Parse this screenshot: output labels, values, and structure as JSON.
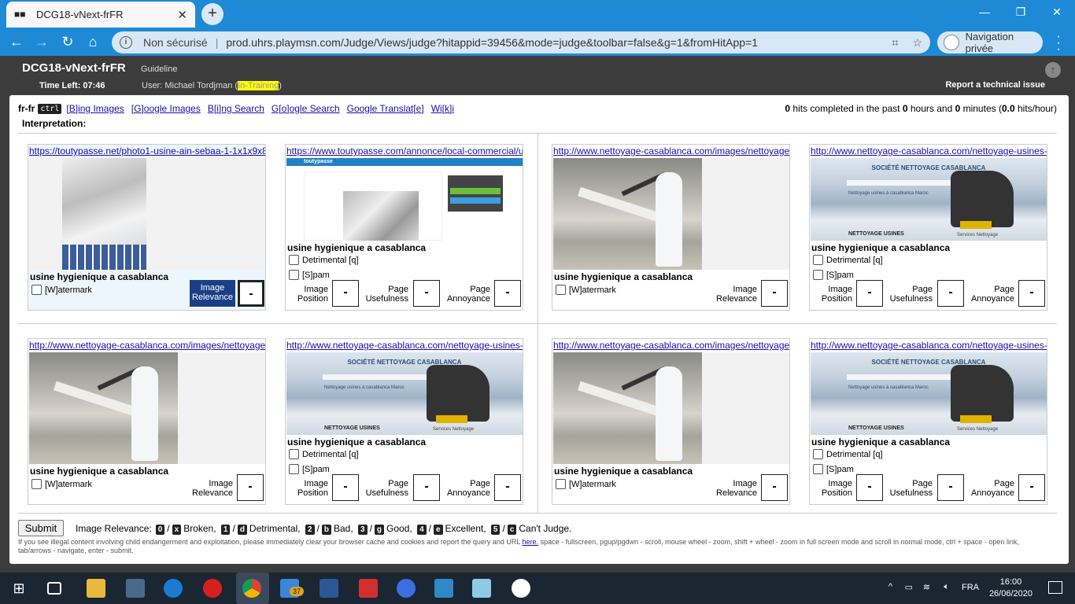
{
  "browser": {
    "tab_title": "DCG18-vNext-frFR",
    "security": "Non sécurisé",
    "url": "prod.uhrs.playmsn.com/Judge/Views/judge?hitappid=39456&mode=judge&toolbar=false&g=1&fromHitApp=1",
    "profile": "Navigation privée"
  },
  "header": {
    "app_name": "DCG18-vNext-frFR",
    "guideline": "Guideline",
    "time_left": "Time Left: 07:46",
    "user_prefix": "User: Michael Tordjman (",
    "user_status": "In-Training",
    "user_suffix": ")",
    "report": "Report a technical issue"
  },
  "toolbar": {
    "locale": "fr-fr",
    "ctrl": "ctrl",
    "links": [
      "[B]ing Images",
      "[G]oogle Images",
      "B[i]ng Search",
      "G[o]ogle Search",
      "Google Translat[e]",
      "Wi[k]i"
    ],
    "interpretation": "Interpretation:",
    "stats_parts": [
      "0",
      " hits completed in the past ",
      "0",
      " hours and ",
      "0",
      " minutes (",
      "0.0",
      " hits/hour)"
    ]
  },
  "cards": [
    {
      "url": "https://toutypasse.net/photo1-usine-ain-sebaa-1-1x1x9x8",
      "query": "usine hygienique a casablanca",
      "type": "image"
    },
    {
      "url": "https://www.toutypasse.com/annonce/local-commercial/u",
      "query": "usine hygienique a casablanca",
      "type": "page"
    },
    {
      "url": "http://www.nettoyage-casablanca.com/images/nettoyage",
      "query": "usine hygienique a casablanca",
      "type": "image"
    },
    {
      "url": "http://www.nettoyage-casablanca.com/nettoyage-usines-",
      "query": "usine hygienique a casablanca",
      "type": "page"
    },
    {
      "url": "http://www.nettoyage-casablanca.com/images/nettoyage",
      "query": "usine hygienique a casablanca",
      "type": "image"
    },
    {
      "url": "http://www.nettoyage-casablanca.com/nettoyage-usines-",
      "query": "usine hygienique a casablanca",
      "type": "page"
    },
    {
      "url": "http://www.nettoyage-casablanca.com/images/nettoyage",
      "query": "usine hygienique a casablanca",
      "type": "image"
    },
    {
      "url": "http://www.nettoyage-casablanca.com/nettoyage-usines-",
      "query": "usine hygienique a casablanca",
      "type": "page"
    }
  ],
  "labels": {
    "watermark": "[W]atermark",
    "detrimental": "Detrimental [q]",
    "spam": "[S]pam",
    "image_relevance_1": "Image",
    "image_relevance_2": "Relevance",
    "image_position_1": "Image",
    "image_position_2": "Position",
    "page_usefulness_1": "Page",
    "page_usefulness_2": "Usefulness",
    "page_annoyance_1": "Page",
    "page_annoyance_2": "Annoyance",
    "rating_value": "-"
  },
  "web_thumbs": {
    "toutypasse_logo": "toutypasse",
    "nettoyage_title": "SOCIÉTÉ NETTOYAGE CASABLANCA",
    "nettoyage_sub": "Nettoyage usines à casablanca Maroc",
    "nettoyage_bottom": "NETTOYAGE USINES",
    "nettoyage_services": "Services Nettoyage"
  },
  "footer": {
    "submit": "Submit",
    "legend_intro": "Image Relevance:",
    "legend": [
      {
        "k1": "0",
        "k2": "x",
        "label": "Broken,"
      },
      {
        "k1": "1",
        "k2": "d",
        "label": "Detrimental,"
      },
      {
        "k1": "2",
        "k2": "b",
        "label": "Bad,"
      },
      {
        "k1": "3",
        "k2": "g",
        "label": "Good,"
      },
      {
        "k1": "4",
        "k2": "e",
        "label": "Excellent,"
      },
      {
        "k1": "5",
        "k2": "c",
        "label": "Can't Judge."
      }
    ],
    "note_1": "If you see illegal content involving child endangerment and exploitation, please immediately clear your browser cache and cookies and report the query and URL ",
    "note_link": "here.",
    "note_2": " space - fullscreen, pgup/pgdwn - scroll, mouse wheel - zoom, shift + wheel - zoom in full screen mode and scroll in normal mode, ctrl + space - open link, tab/arrows - navigate, enter - submit."
  },
  "taskbar": {
    "mail_badge": "37",
    "lang": "FRA",
    "time": "16:00",
    "date": "26/06/2020"
  }
}
